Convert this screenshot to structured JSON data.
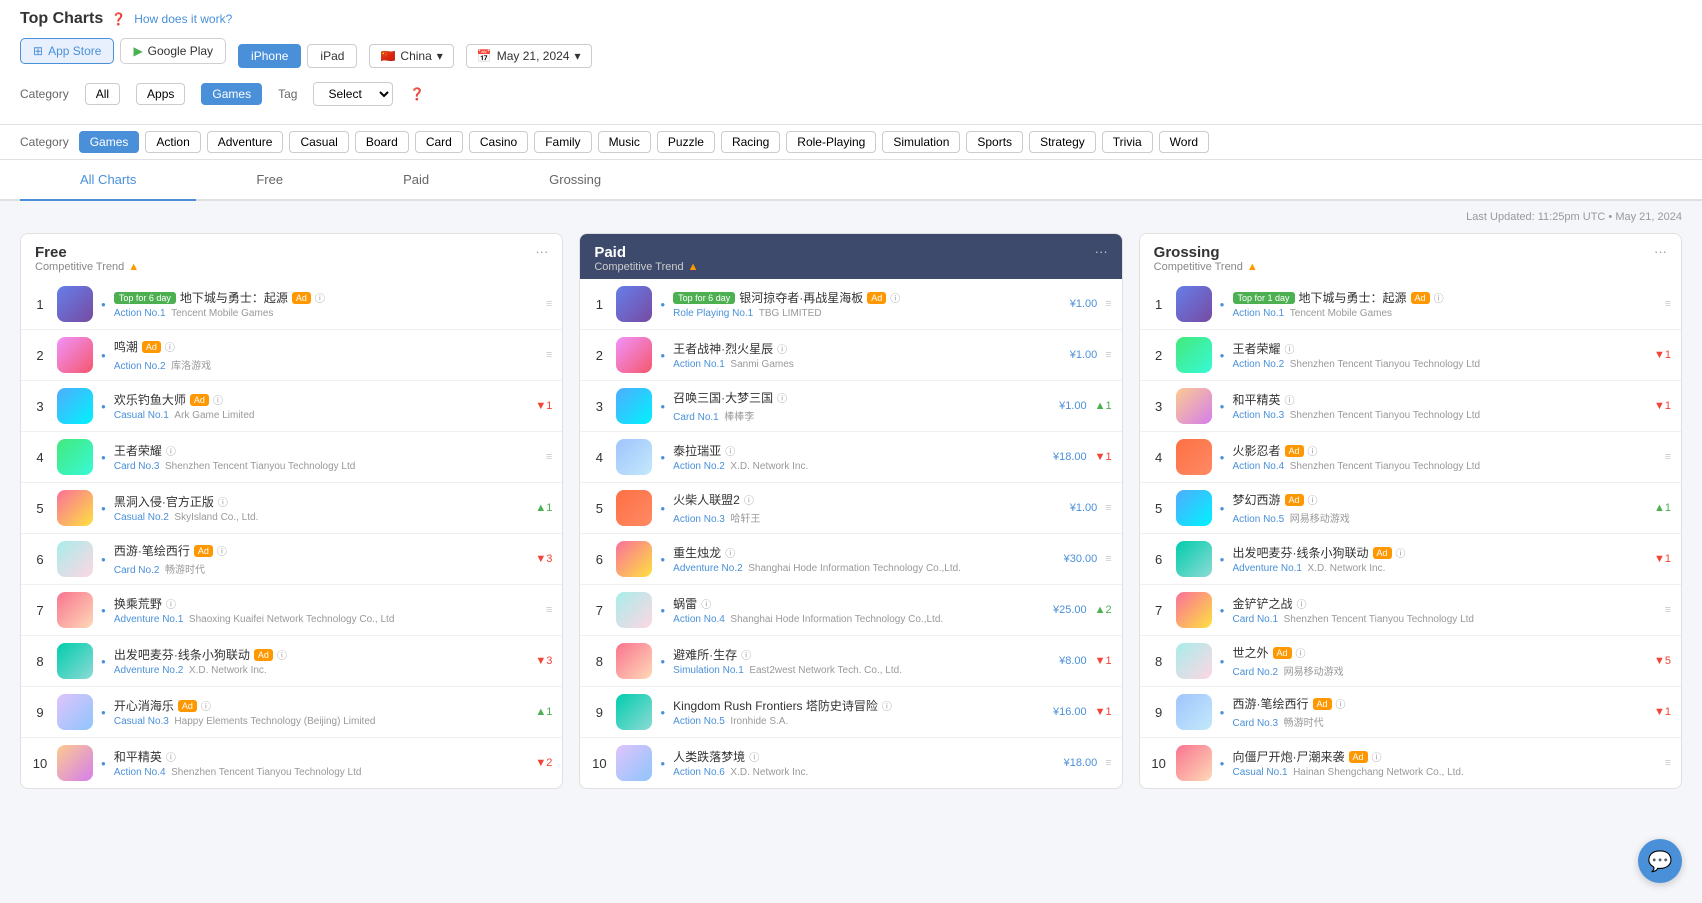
{
  "page": {
    "title": "Top Charts",
    "help_link": "How does it work?",
    "last_updated": "Last Updated: 11:25pm UTC • May 21, 2024"
  },
  "stores": [
    {
      "id": "appstore",
      "label": "App Store",
      "active": true
    },
    {
      "id": "googleplay",
      "label": "Google Play",
      "active": false
    }
  ],
  "devices": [
    {
      "id": "iphone",
      "label": "iPhone",
      "active": true
    },
    {
      "id": "ipad",
      "label": "iPad",
      "active": false
    }
  ],
  "country": {
    "label": "China",
    "flag": "🇨🇳"
  },
  "date": {
    "label": "May 21, 2024"
  },
  "category_tabs": [
    {
      "id": "all",
      "label": "All",
      "active": false
    },
    {
      "id": "apps",
      "label": "Apps",
      "active": false
    },
    {
      "id": "games",
      "label": "Games",
      "active": true
    }
  ],
  "tag_placeholder": "Select",
  "categories": [
    {
      "id": "games",
      "label": "Games",
      "active": true
    },
    {
      "id": "action",
      "label": "Action",
      "active": false
    },
    {
      "id": "adventure",
      "label": "Adventure",
      "active": false
    },
    {
      "id": "casual",
      "label": "Casual",
      "active": false
    },
    {
      "id": "board",
      "label": "Board",
      "active": false
    },
    {
      "id": "card",
      "label": "Card",
      "active": false
    },
    {
      "id": "casino",
      "label": "Casino",
      "active": false
    },
    {
      "id": "family",
      "label": "Family",
      "active": false
    },
    {
      "id": "music",
      "label": "Music",
      "active": false
    },
    {
      "id": "puzzle",
      "label": "Puzzle",
      "active": false
    },
    {
      "id": "racing",
      "label": "Racing",
      "active": false
    },
    {
      "id": "roleplaying",
      "label": "Role-Playing",
      "active": false
    },
    {
      "id": "simulation",
      "label": "Simulation",
      "active": false
    },
    {
      "id": "sports",
      "label": "Sports",
      "active": false
    },
    {
      "id": "strategy",
      "label": "Strategy",
      "active": false
    },
    {
      "id": "trivia",
      "label": "Trivia",
      "active": false
    },
    {
      "id": "word",
      "label": "Word",
      "active": false
    }
  ],
  "chart_tabs": [
    {
      "id": "all",
      "label": "All Charts",
      "active": true
    },
    {
      "id": "free",
      "label": "Free",
      "active": false
    },
    {
      "id": "paid",
      "label": "Paid",
      "active": false
    },
    {
      "id": "grossing",
      "label": "Grossing",
      "active": false
    }
  ],
  "free_chart": {
    "title": "Free",
    "trend_label": "Competitive Trend",
    "items": [
      {
        "rank": 1,
        "name": "地下城与勇士：起源",
        "badge": "Top for 6 day",
        "ad": true,
        "category": "Action No.1",
        "publisher": "Tencent Mobile Games",
        "change": "stable",
        "change_val": "",
        "icon_class": "icon-1"
      },
      {
        "rank": 2,
        "name": "鸣潮",
        "ad": true,
        "category": "Action No.2",
        "publisher": "库洛游戏",
        "change": "stable",
        "change_val": "",
        "icon_class": "icon-2"
      },
      {
        "rank": 3,
        "name": "欢乐钓鱼大师",
        "ad": true,
        "category": "Casual No.1",
        "publisher": "Ark Game Limited",
        "change": "down",
        "change_val": "1",
        "icon_class": "icon-3"
      },
      {
        "rank": 4,
        "name": "王者荣耀",
        "category": "Card No.3",
        "publisher": "Shenzhen Tencent Tianyou Technology Ltd",
        "change": "stable",
        "change_val": "",
        "icon_class": "icon-4"
      },
      {
        "rank": 5,
        "name": "黑洞入侵·官方正版",
        "category": "Casual No.2",
        "publisher": "SkyIsland Co., Ltd.",
        "change": "up",
        "change_val": "1",
        "icon_class": "icon-5"
      },
      {
        "rank": 6,
        "name": "西游·笔绘西行",
        "ad": true,
        "category": "Card No.2",
        "publisher": "畅游时代",
        "change": "down",
        "change_val": "3",
        "icon_class": "icon-6"
      },
      {
        "rank": 7,
        "name": "换乘荒野",
        "category": "Adventure No.1",
        "publisher": "Shaoxing Kuaifei Network Technology Co., Ltd",
        "change": "stable",
        "change_val": "",
        "icon_class": "icon-7"
      },
      {
        "rank": 8,
        "name": "出发吧麦芬·线条小狗联动",
        "ad": true,
        "category": "Adventure No.2",
        "publisher": "X.D. Network Inc.",
        "change": "down",
        "change_val": "3",
        "icon_class": "icon-8"
      },
      {
        "rank": 9,
        "name": "开心消海乐",
        "ad": true,
        "category": "Casual No.3",
        "publisher": "Happy Elements Technology (Beijing) Limited",
        "change": "up",
        "change_val": "1",
        "icon_class": "icon-9"
      },
      {
        "rank": 10,
        "name": "和平精英",
        "category": "Action No.4",
        "publisher": "Shenzhen Tencent Tianyou Technology Ltd",
        "change": "down",
        "change_val": "2",
        "icon_class": "icon-10"
      }
    ]
  },
  "paid_chart": {
    "title": "Paid",
    "trend_label": "Competitive Trend",
    "dark": true,
    "items": [
      {
        "rank": 1,
        "name": "银河掠夺者·再战星海板",
        "badge": "Top for 6 day",
        "ad": true,
        "category": "Role Playing No.1",
        "publisher": "TBG LIMITED",
        "price": "¥1.00",
        "change": "stable",
        "change_val": "",
        "icon_class": "icon-1"
      },
      {
        "rank": 2,
        "name": "王者战神·烈火星辰",
        "category": "Action No.1",
        "publisher": "Sanmi Games",
        "price": "¥1.00",
        "change": "stable",
        "change_val": "",
        "icon_class": "icon-2"
      },
      {
        "rank": 3,
        "name": "召唤三国·大梦三国",
        "category": "Card No.1",
        "publisher": "棒棒李",
        "price": "¥1.00",
        "change": "up",
        "change_val": "1",
        "icon_class": "icon-3"
      },
      {
        "rank": 4,
        "name": "泰拉瑞亚",
        "category": "Action No.2",
        "publisher": "X.D. Network Inc.",
        "price": "¥18.00",
        "change": "down",
        "change_val": "1",
        "icon_class": "icon-11"
      },
      {
        "rank": 5,
        "name": "火柴人联盟2",
        "category": "Action No.3",
        "publisher": "哈轩王",
        "price": "¥1.00",
        "change": "stable",
        "change_val": "",
        "icon_class": "icon-12"
      },
      {
        "rank": 6,
        "name": "重生烛龙",
        "category": "Adventure No.2",
        "publisher": "Shanghai Hode Information Technology Co.,Ltd.",
        "price": "¥30.00",
        "change": "stable",
        "change_val": "",
        "icon_class": "icon-5"
      },
      {
        "rank": 7,
        "name": "蜗雷",
        "category": "Action No.4",
        "publisher": "Shanghai Hode Information Technology Co.,Ltd.",
        "price": "¥25.00",
        "change": "up",
        "change_val": "2",
        "icon_class": "icon-6"
      },
      {
        "rank": 8,
        "name": "避难所·生存",
        "category": "Simulation No.1",
        "publisher": "East2west Network Tech. Co., Ltd.",
        "price": "¥8.00",
        "change": "down",
        "change_val": "1",
        "icon_class": "icon-7"
      },
      {
        "rank": 9,
        "name": "Kingdom Rush Frontiers 塔防史诗冒险",
        "category": "Action No.5",
        "publisher": "Ironhide S.A.",
        "price": "¥16.00",
        "change": "down",
        "change_val": "1",
        "icon_class": "icon-8"
      },
      {
        "rank": 10,
        "name": "人类跌落梦境",
        "category": "Action No.6",
        "publisher": "X.D. Network Inc.",
        "price": "¥18.00",
        "change": "stable",
        "change_val": "",
        "icon_class": "icon-9"
      }
    ]
  },
  "grossing_chart": {
    "title": "Grossing",
    "trend_label": "Competitive Trend",
    "items": [
      {
        "rank": 1,
        "name": "地下城与勇士：起源",
        "badge": "Top for 1 day",
        "ad": true,
        "category": "Action No.1",
        "publisher": "Tencent Mobile Games",
        "change": "stable",
        "change_val": "",
        "icon_class": "icon-1"
      },
      {
        "rank": 2,
        "name": "王者荣耀",
        "category": "Action No.2",
        "publisher": "Shenzhen Tencent Tianyou Technology Ltd",
        "change": "down",
        "change_val": "1",
        "icon_class": "icon-4"
      },
      {
        "rank": 3,
        "name": "和平精英",
        "category": "Action No.3",
        "publisher": "Shenzhen Tencent Tianyou Technology Ltd",
        "change": "down",
        "change_val": "1",
        "icon_class": "icon-10"
      },
      {
        "rank": 4,
        "name": "火影忍者",
        "ad": true,
        "category": "Action No.4",
        "publisher": "Shenzhen Tencent Tianyou Technology Ltd",
        "change": "stable",
        "change_val": "",
        "icon_class": "icon-12"
      },
      {
        "rank": 5,
        "name": "梦幻西游",
        "ad": true,
        "category": "Action No.5",
        "publisher": "网易移动游戏",
        "change": "up",
        "change_val": "1",
        "icon_class": "icon-3"
      },
      {
        "rank": 6,
        "name": "出发吧麦芬·线条小狗联动",
        "ad": true,
        "category": "Adventure No.1",
        "publisher": "X.D. Network Inc.",
        "change": "down",
        "change_val": "1",
        "icon_class": "icon-8"
      },
      {
        "rank": 7,
        "name": "金铲铲之战",
        "category": "Card No.1",
        "publisher": "Shenzhen Tencent Tianyou Technology Ltd",
        "change": "stable",
        "change_val": "",
        "icon_class": "icon-5"
      },
      {
        "rank": 8,
        "name": "世之外",
        "ad": true,
        "category": "Card No.2",
        "publisher": "网易移动游戏",
        "change": "down",
        "change_val": "5",
        "icon_class": "icon-6"
      },
      {
        "rank": 9,
        "name": "西游·笔绘西行",
        "ad": true,
        "category": "Card No.3",
        "publisher": "畅游时代",
        "change": "down",
        "change_val": "1",
        "icon_class": "icon-11"
      },
      {
        "rank": 10,
        "name": "向僵尸开炮·尸潮来袭",
        "ad": true,
        "category": "Casual No.1",
        "publisher": "Hainan Shengchang Network Co., Ltd.",
        "change": "stable",
        "change_val": "",
        "icon_class": "icon-7"
      }
    ]
  }
}
